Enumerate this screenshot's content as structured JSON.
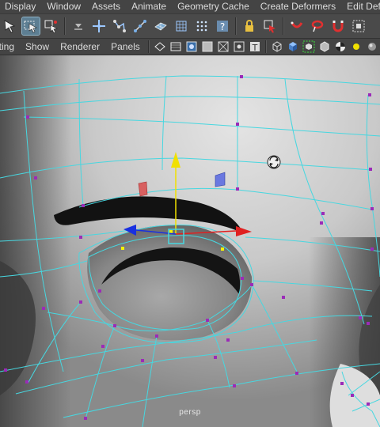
{
  "app": {
    "menubar": {
      "items": [
        "Display",
        "Window",
        "Assets",
        "Animate",
        "Geometry Cache",
        "Create Deformers",
        "Edit Deformers"
      ]
    },
    "shelf": {
      "buttons": [
        "select-tool-icon",
        "lasso-select-icon",
        "paint-select-icon",
        "shelf-options-icon",
        "move-cluster-icon",
        "ik-handle-icon",
        "skin-bind-icon",
        "lattice-icon",
        "wire-deformer-icon",
        "sculpt-icon",
        "help-icon",
        "lock-icon",
        "component-select-icon",
        "magnet-red-icon",
        "lasso-red-icon",
        "magnet-icon",
        "script-node-icon"
      ],
      "active_button": "lasso-select-icon"
    },
    "panel": {
      "menus": [
        "nting",
        "Show",
        "Renderer",
        "Panels"
      ],
      "toolbar_icons": [
        "wireframe-shaded-icon",
        "wireframe-icon",
        "shaded-icon",
        "smooth-shade-icon",
        "xray-icon",
        "xray-joints-icon",
        "texture-icon",
        "cube-wire-icon",
        "cube-shaded-icon",
        "isolate-icon",
        "cube-bounds-icon",
        "checker-icon",
        "light-icon",
        "sphere-shaded-icon",
        "sphere-white-icon",
        "fire-icon",
        "shader-ball-icon",
        "selection-frame-icon",
        "cube-icon"
      ]
    },
    "viewport": {
      "camera": "persp"
    },
    "colors": {
      "ui_bg": "#444444",
      "wire": "#47d7e0",
      "vertex": "#9b2bb8",
      "selected_vertex": "#f4f400",
      "axis_y": "#f0e000",
      "axis_x": "#e02020",
      "axis_z": "#1830e0"
    }
  }
}
